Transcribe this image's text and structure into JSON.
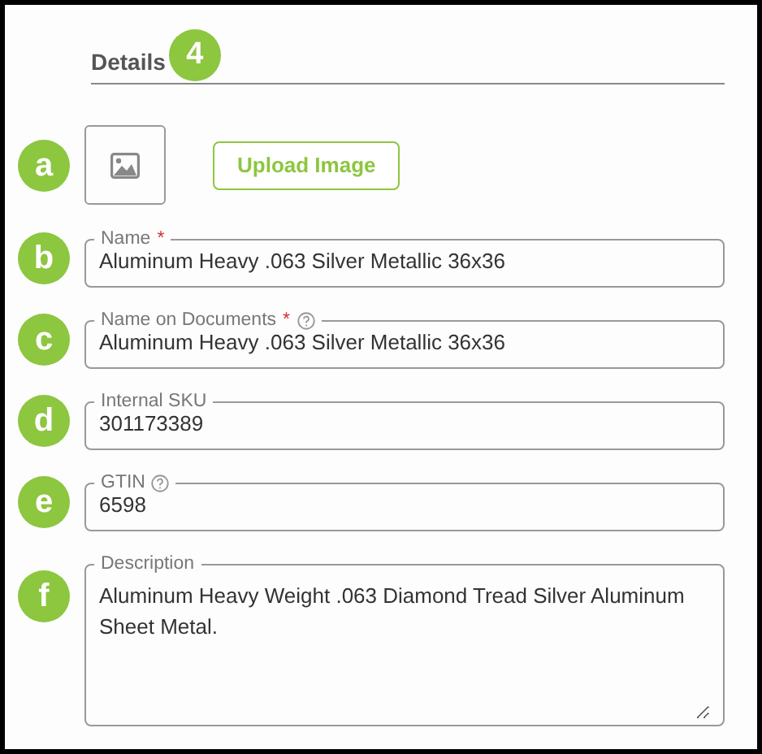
{
  "section": {
    "title": "Details",
    "step_badge": "4"
  },
  "image_row": {
    "badge": "a",
    "button": "Upload Image"
  },
  "fields": [
    {
      "kind": "text",
      "badge": "b",
      "label": "Name",
      "required_mark": "*",
      "help": false,
      "value": "Aluminum Heavy .063 Silver Metallic 36x36"
    },
    {
      "kind": "text",
      "badge": "c",
      "label": "Name on Documents",
      "required_mark": "*",
      "help": true,
      "value": "Aluminum Heavy .063 Silver Metallic 36x36"
    },
    {
      "kind": "text",
      "badge": "d",
      "label": "Internal SKU",
      "help": false,
      "value": "301173389"
    },
    {
      "kind": "text",
      "badge": "e",
      "label": "GTIN",
      "help": true,
      "value": "6598"
    },
    {
      "kind": "textarea",
      "badge": "f",
      "label": "Description",
      "help": false,
      "value": "Aluminum Heavy Weight .063 Diamond Tread Silver Aluminum Sheet Metal."
    }
  ]
}
